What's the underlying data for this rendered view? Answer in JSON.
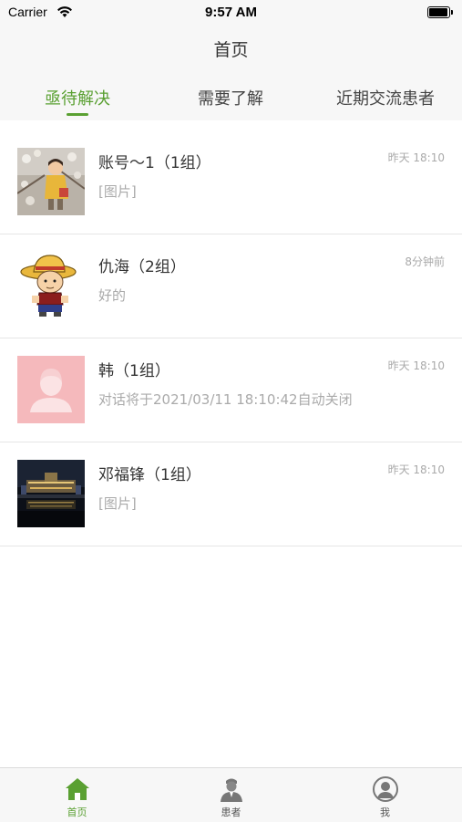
{
  "status_bar": {
    "carrier": "Carrier",
    "time": "9:57 AM"
  },
  "nav": {
    "title": "首页"
  },
  "tabs": [
    {
      "label": "亟待解决",
      "active": true
    },
    {
      "label": "需要了解",
      "active": false
    },
    {
      "label": "近期交流患者",
      "active": false
    }
  ],
  "conversations": [
    {
      "name": "账号～1（1组）",
      "preview": "[图片]",
      "time": "昨天 18:10",
      "avatar": "girl-photo"
    },
    {
      "name": "仇海（2组）",
      "preview": "好的",
      "time": "8分钟前",
      "avatar": "cartoon-boy"
    },
    {
      "name": "韩（1组）",
      "preview": "对话将于2021/03/11 18:10:42自动关闭",
      "time": "昨天 18:10",
      "avatar": "default-person"
    },
    {
      "name": "邓福锋（1组）",
      "preview": "[图片]",
      "time": "昨天 18:10",
      "avatar": "night-city-photo"
    }
  ],
  "tab_bar": [
    {
      "label": "首页",
      "icon": "home-icon",
      "active": true
    },
    {
      "label": "患者",
      "icon": "doctor-icon",
      "active": false
    },
    {
      "label": "我",
      "icon": "profile-icon",
      "active": false
    }
  ],
  "colors": {
    "accent": "#5aa032",
    "background": "#f7f7f7",
    "secondary_text": "#aaaaaa"
  }
}
